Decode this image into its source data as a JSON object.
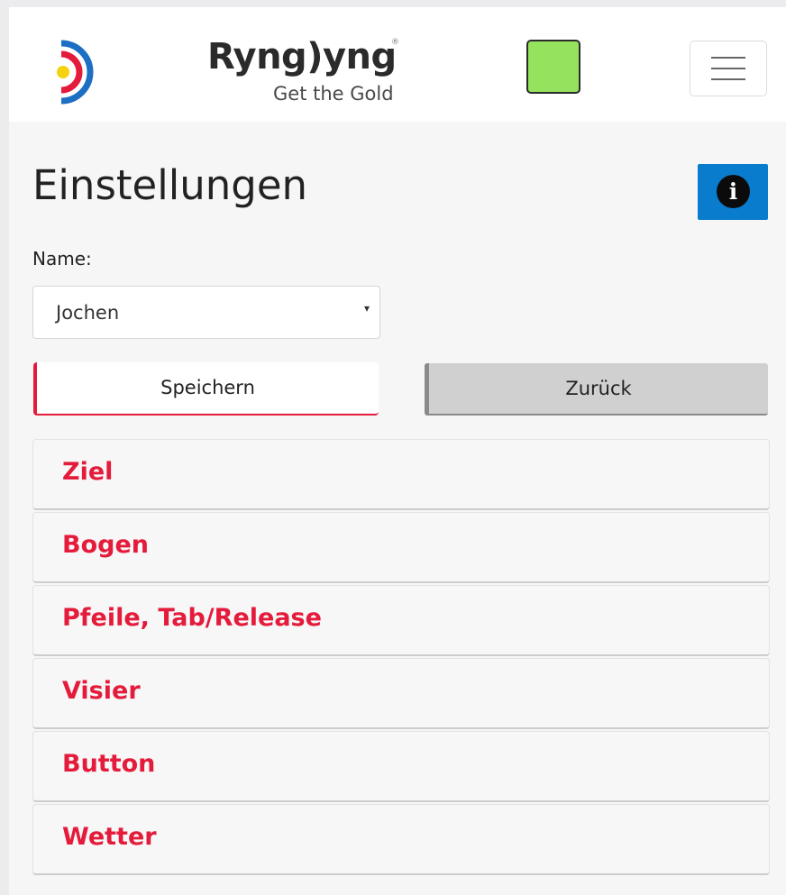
{
  "header": {
    "logo_icon": "target-ring-icon",
    "brand_name": "Ryng)yng",
    "brand_reg": "®",
    "tagline": "Get the Gold",
    "status_color": "#95e25e",
    "menu_icon": "hamburger-menu-icon"
  },
  "page": {
    "title": "Einstellungen",
    "info_icon": "info-icon",
    "info_glyph": "i",
    "info_color": "#0a7ccd"
  },
  "form": {
    "name_label": "Name:",
    "name_value": "Jochen",
    "select_caret": "▾"
  },
  "actions": {
    "save_label": "Speichern",
    "back_label": "Zurück"
  },
  "sections": {
    "accent_color": "#e41b3a",
    "items": [
      "Ziel",
      "Bogen",
      "Pfeile, Tab/Release",
      "Visier",
      "Button",
      "Wetter"
    ]
  }
}
